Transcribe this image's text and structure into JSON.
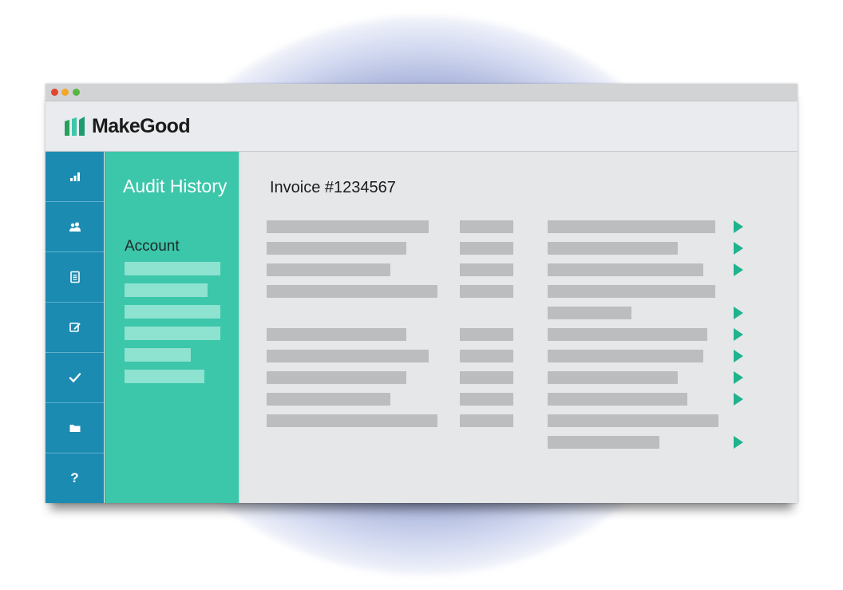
{
  "app": {
    "brand": "MakeGood",
    "logo_icon": "bar-chart-logo-icon",
    "brand_color": "#3cc6aa",
    "sidebar_color": "#1b8bb2"
  },
  "window_controls": [
    "close",
    "minimize",
    "maximize"
  ],
  "icon_sidebar": [
    {
      "name": "analytics-icon"
    },
    {
      "name": "users-icon"
    },
    {
      "name": "document-icon"
    },
    {
      "name": "edit-icon"
    },
    {
      "name": "check-icon"
    },
    {
      "name": "folder-icon"
    },
    {
      "name": "help-icon",
      "glyph": "?"
    }
  ],
  "subnav": {
    "title": "Audit History",
    "section": "Account"
  },
  "main": {
    "invoice_title": "Invoice #1234567"
  }
}
